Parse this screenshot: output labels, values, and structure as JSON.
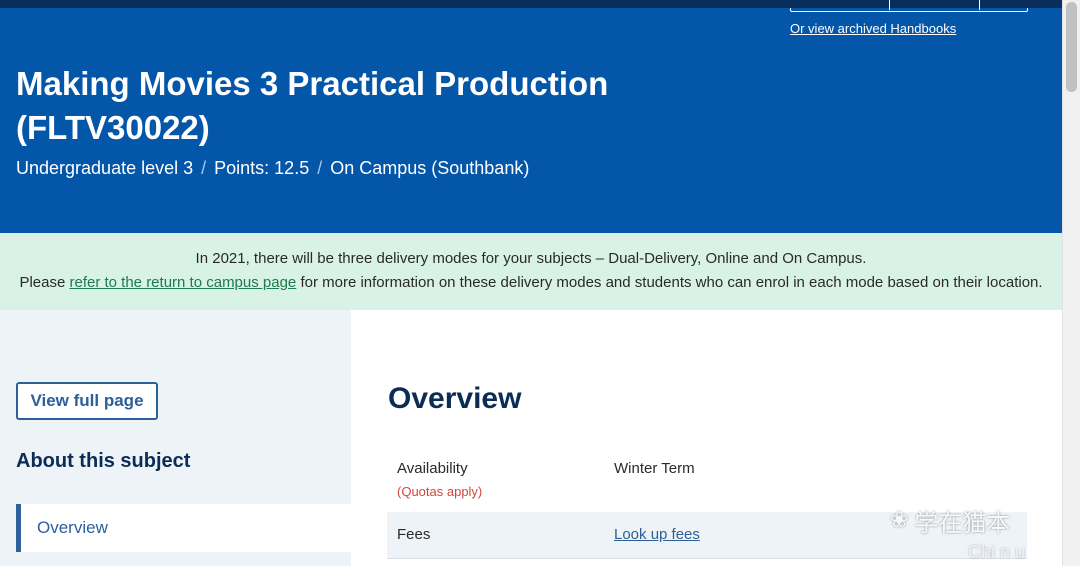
{
  "header": {
    "archived_link": "Or view archived Handbooks",
    "title": "Making Movies 3 Practical Production (FLTV30022)",
    "meta": {
      "level": "Undergraduate level 3",
      "points": "Points: 12.5",
      "campus": "On Campus (Southbank)",
      "separator": "/"
    }
  },
  "notice": {
    "line1": "In 2021, there will be three delivery modes for your subjects – Dual-Delivery, Online and On Campus.",
    "line2_prefix": "Please ",
    "line2_link": "refer to the return to campus page",
    "line2_suffix": " for more information on these delivery modes and students who can enrol in each mode based on their location."
  },
  "sidebar": {
    "view_full_page": "View full page",
    "about_heading": "About this subject",
    "nav_items": [
      {
        "label": "Overview"
      }
    ]
  },
  "main": {
    "heading": "Overview",
    "rows": [
      {
        "label": "Availability",
        "sublabel": "(Quotas apply)",
        "value": "Winter Term"
      },
      {
        "label": "Fees",
        "value": "Look up fees"
      }
    ]
  },
  "watermark": {
    "icon": "wechat-icon",
    "text": "学在猫本",
    "sub": "Chi n  u"
  },
  "colors": {
    "hero_bg": "#0456a9",
    "notice_bg": "#d8f2e6",
    "sidebar_bg": "#eef3f8",
    "heading": "#0b2d55",
    "link": "#2d5f99",
    "quota_red": "#d0473b"
  }
}
